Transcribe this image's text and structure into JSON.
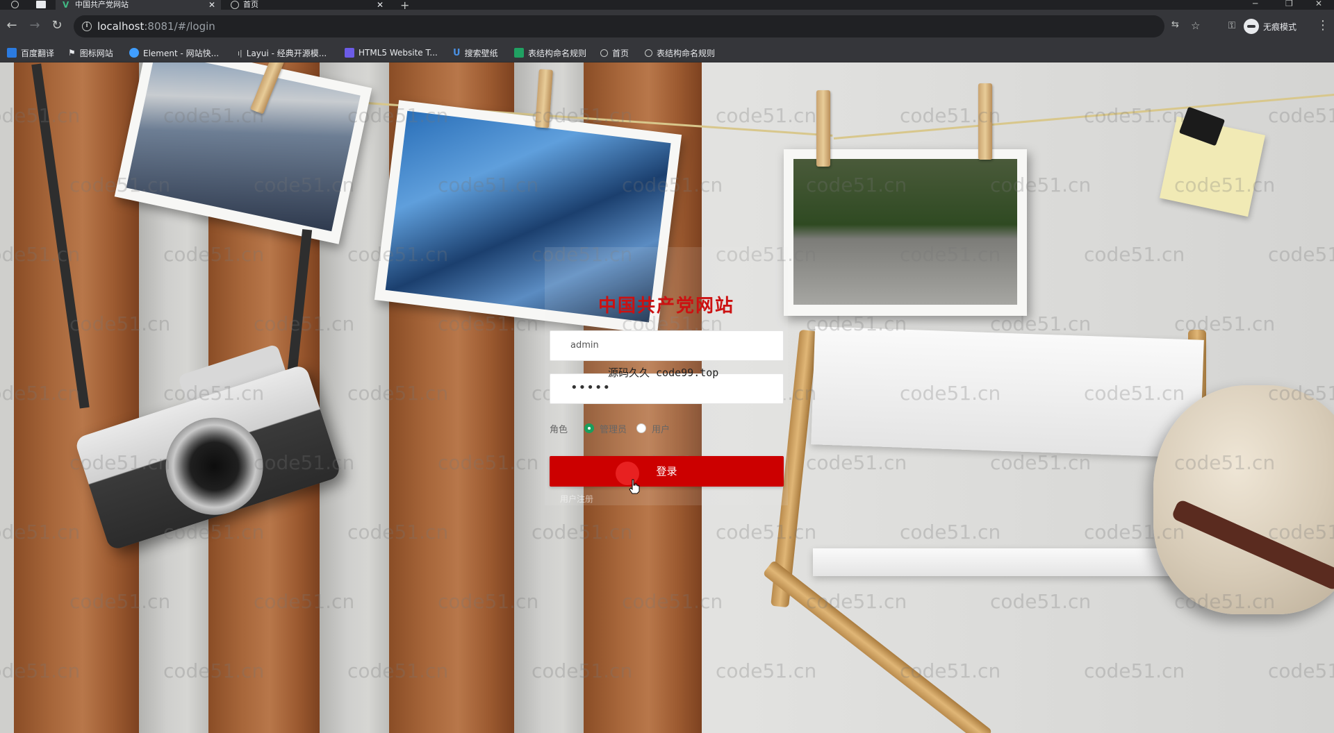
{
  "browser": {
    "tabs": [
      {
        "title": "中国共产党网站",
        "active": true,
        "icon": "vue-logo-icon"
      },
      {
        "title": "首页",
        "active": false,
        "icon": "globe-icon"
      }
    ],
    "url_host": "localhost",
    "url_rest": ":8081/#/login",
    "profile_label": "无痕模式",
    "bookmarks": [
      {
        "label": "百度翻译",
        "icon": "baidu-translate-icon",
        "color": "#2b7be0"
      },
      {
        "label": "图标网站",
        "icon": "flag-icon",
        "color": "#e8eaed"
      },
      {
        "label": "Element - 网站快...",
        "icon": "element-icon",
        "color": "#409eff"
      },
      {
        "label": "Layui - 经典开源模...",
        "icon": "layui-icon",
        "color": "#c4c7c5"
      },
      {
        "label": "HTML5 Website T...",
        "icon": "html5-icon",
        "color": "#6c5ce7"
      },
      {
        "label": "搜索壁纸",
        "icon": "wallpaper-icon",
        "color": "#4a90e2"
      },
      {
        "label": "表结构命名规则",
        "icon": "table-icon",
        "color": "#20a162"
      },
      {
        "label": "首页",
        "icon": "globe-icon",
        "color": "#c4c7c5"
      },
      {
        "label": "表结构命名规则",
        "icon": "globe-icon",
        "color": "#c4c7c5"
      }
    ]
  },
  "page": {
    "watermark_text": "code51.cn",
    "login": {
      "title": "中国共产党网站",
      "username_value": "admin",
      "password_value": "•••••",
      "overlay_text": "源码久久 code99.top",
      "role_label": "角色",
      "roles": [
        {
          "label": "管理员",
          "checked": true
        },
        {
          "label": "用户",
          "checked": false
        }
      ],
      "login_button": "登录",
      "register_text": "用户注册"
    }
  },
  "colors": {
    "accent_red": "#cc0000",
    "title_red": "#cc1111",
    "radio_checked": "#1a9e5c"
  }
}
